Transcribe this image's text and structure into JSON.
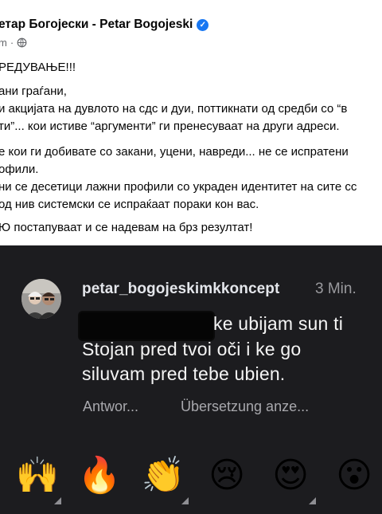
{
  "post": {
    "author": "етар Богојески - Petar Bogojeski",
    "time": "m",
    "dot": "·",
    "lines": [
      "РЕДУВАЊЕ!!!",
      "ани граѓани,",
      "и акцијата на дувлото на сдс и дуи, поттикнати од средби со “в",
      "ти”... кои истиве “аргументи” ги пренесуваат на други адреси.",
      "е кои ги добивате со закани, уцени, навреди... не се испратени",
      "офили.",
      "ни се десетици лажни профили со украден идентитет на сите сс",
      "од нив системски се испраќаат пораки кон вас.",
      "Ю постапуваат и се надевам на брз резултат!"
    ]
  },
  "comment": {
    "username": "petar_bogojeskimkkoncept",
    "time": "3 Min.",
    "line1": "ke ubijam sun ti",
    "line2": "Stojan pred tvoi oči i ke go",
    "line3": "siluvam pred tebe ubien.",
    "reply_label": "Antwor...",
    "translate_label": "Übersetzung anze..."
  },
  "reactions": [
    {
      "name": "raising-hands-icon",
      "glyph": "🙌"
    },
    {
      "name": "fire-icon",
      "glyph": "🔥"
    },
    {
      "name": "clapping-hands-icon",
      "glyph": "👏"
    },
    {
      "name": "crying-face-icon",
      "glyph": "😢"
    },
    {
      "name": "heart-eyes-face-icon",
      "glyph": "😍"
    },
    {
      "name": "surprised-face-icon",
      "glyph": "😮"
    }
  ],
  "colors": {
    "verified": "#1877f2",
    "story_bg": "#1c1c1f",
    "comment_text": "#f5f5f5"
  }
}
